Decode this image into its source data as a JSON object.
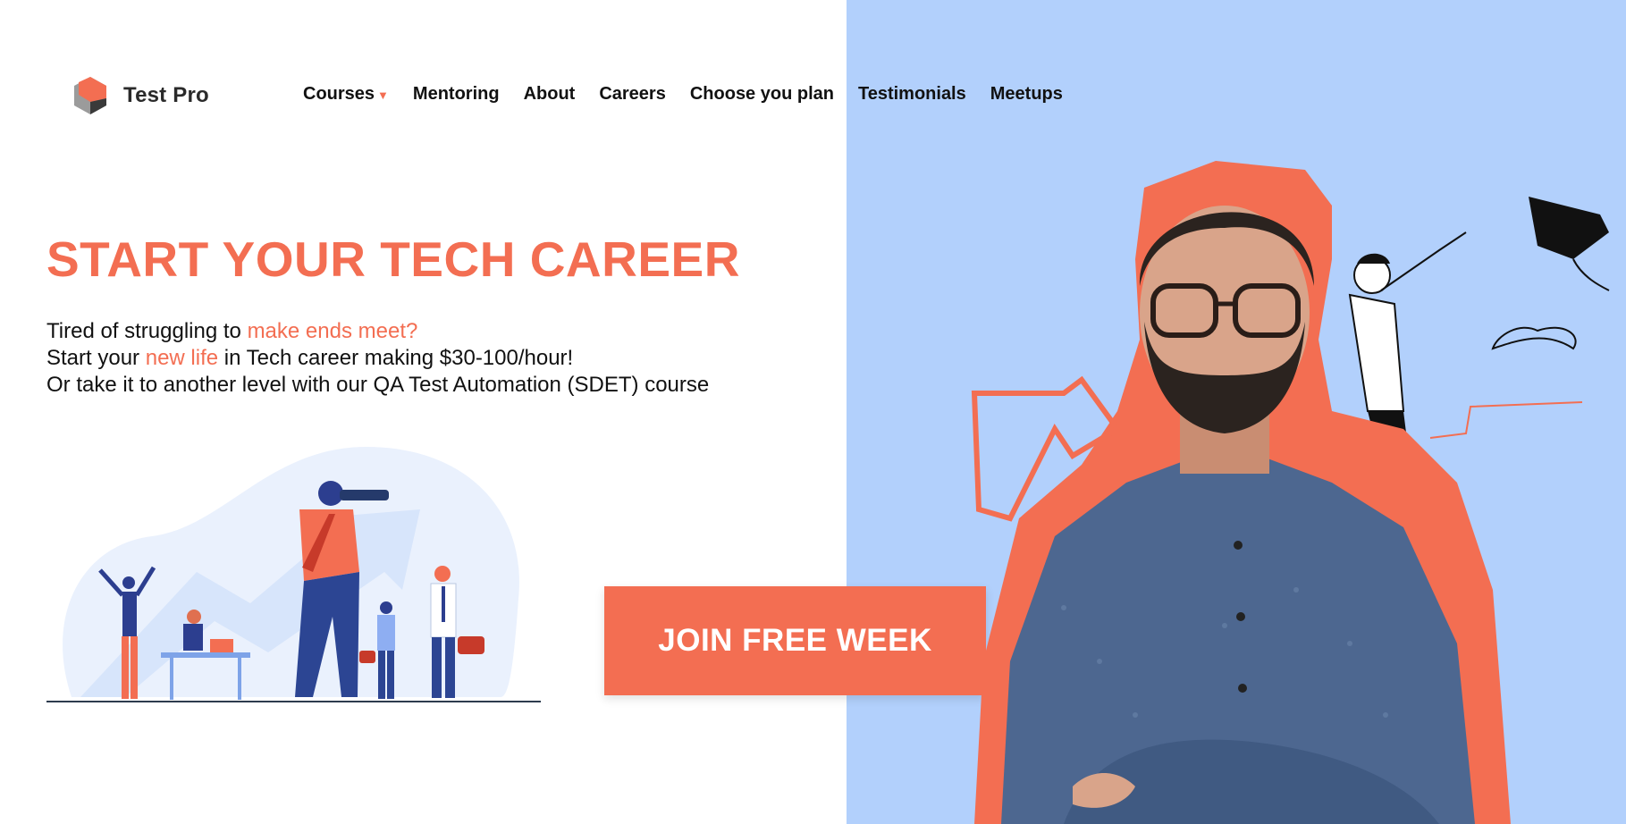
{
  "brand": {
    "name": "Test Pro",
    "accent": "#f36e52",
    "panel_bg": "#b2d0fc"
  },
  "nav": {
    "items": [
      {
        "label": "Courses",
        "has_dropdown": true
      },
      {
        "label": "Mentoring"
      },
      {
        "label": "About"
      },
      {
        "label": "Careers"
      },
      {
        "label": "Choose you plan"
      },
      {
        "label": "Testimonials"
      },
      {
        "label": "Meetups"
      }
    ]
  },
  "hero": {
    "title": "START YOUR TECH CAREER",
    "line1_a": "Tired of struggling to ",
    "line1_hl": "make ends meet?",
    "line2_a": "Start your ",
    "line2_hl": "new life",
    "line2_b": " in Tech career making $30-100/hour!",
    "line3": "Or take it to another level with our QA Test Automation (SDET) course",
    "cta": "JOIN FREE WEEK"
  },
  "icons": [
    "logo-hexagon-icon",
    "caret-down-icon"
  ]
}
